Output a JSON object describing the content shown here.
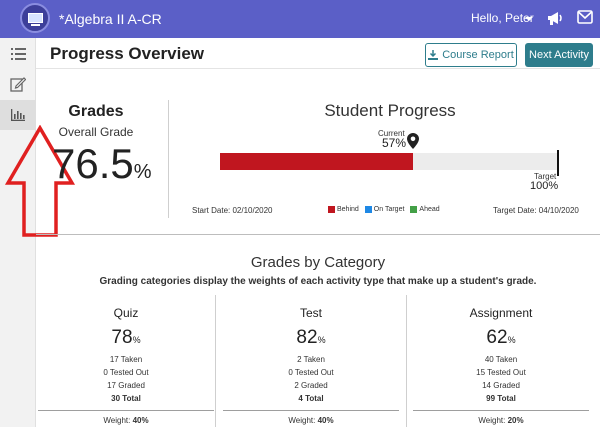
{
  "header": {
    "course_title": "*Algebra II A-CR",
    "greeting": "Hello, Peter",
    "icons": [
      "course-logo-icon",
      "megaphone-icon",
      "mail-icon"
    ]
  },
  "sidebar": {
    "items": [
      {
        "icon": "list-icon",
        "active": false
      },
      {
        "icon": "edit-icon",
        "active": false
      },
      {
        "icon": "bar-chart-icon",
        "active": true
      }
    ]
  },
  "page": {
    "title": "Progress Overview",
    "course_report_label": "Course Report",
    "next_activity_label": "Next Activity"
  },
  "grades": {
    "title": "Grades",
    "overall_label": "Overall Grade",
    "overall_value": "76.5",
    "overall_unit": "%"
  },
  "progress": {
    "title": "Student Progress",
    "current_label": "Current",
    "current_value": "57%",
    "current_fraction": 0.57,
    "target_label": "Target",
    "target_value": "100%",
    "start_date": "Start Date: 02/10/2020",
    "target_date": "Target Date: 04/10/2020",
    "legend": [
      {
        "label": "Behind",
        "color": "#c0161f"
      },
      {
        "label": "On Target",
        "color": "#1e88e5"
      },
      {
        "label": "Ahead",
        "color": "#43a047"
      }
    ]
  },
  "categories": {
    "title": "Grades by Category",
    "subtitle": "Grading categories display the weights of each activity type that make up a student's grade.",
    "items": [
      {
        "name": "Quiz",
        "grade": "78",
        "unit": "%",
        "taken": "17 Taken",
        "tested_out": "0 Tested Out",
        "graded": "17 Graded",
        "total": "30 Total",
        "weight_label": "Weight:",
        "weight": "40%"
      },
      {
        "name": "Test",
        "grade": "82",
        "unit": "%",
        "taken": "2 Taken",
        "tested_out": "0 Tested Out",
        "graded": "2 Graded",
        "total": "4 Total",
        "weight_label": "Weight:",
        "weight": "40%"
      },
      {
        "name": "Assignment",
        "grade": "62",
        "unit": "%",
        "taken": "40 Taken",
        "tested_out": "15 Tested Out",
        "graded": "14 Graded",
        "total": "99 Total",
        "weight_label": "Weight:",
        "weight": "20%"
      }
    ]
  },
  "colors": {
    "topbar": "#5b5fc7",
    "accent": "#2e7d8c",
    "behind": "#c0161f",
    "annotation": "#e02020"
  }
}
